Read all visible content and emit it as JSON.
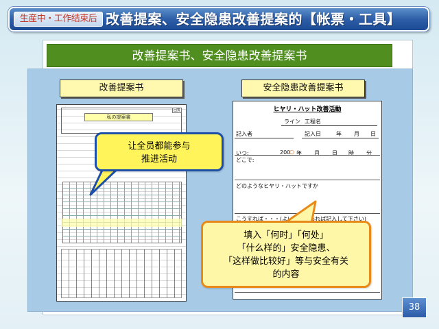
{
  "header": {
    "tag": "生産中・工作结束后",
    "title": "改善提案、安全隐患改善提案的【帐票・工具】"
  },
  "section_title": "改善提案书、安全隐患改善提案书",
  "labels": {
    "left": "改善提案书",
    "right": "安全隐患改善提案书"
  },
  "right_form": {
    "title": "ヒヤリ・ハット改善活動",
    "line_label": "ライン",
    "process_label": "工程名",
    "author_label": "記入者",
    "date_label": "記入日",
    "year": "年",
    "month": "月",
    "day": "日",
    "when_label": "いつ:",
    "when_year": "200",
    "when_day": "日",
    "when_hour": "時",
    "when_minute": "分",
    "where_label": "どこで:",
    "what_label": "どのようなヒヤリ・ハットですか",
    "how_label": "こうすれば・・・(よい方法があれば記入して下さい)"
  },
  "left_form": {
    "stamp_text": "私の提案書",
    "corner_text": "回覧"
  },
  "callouts": {
    "blue": [
      "让全员都能参与",
      "推进活动"
    ],
    "orange": [
      "填入「何时」「何处」",
      "「什么样的」安全隐患、",
      "「这样做比较好」等与安全有关",
      "的内容"
    ]
  },
  "page_number": "38",
  "colors": {
    "title_bar": "#2e5ea8",
    "section_green": "#4f8e1f",
    "panel_blue": "#a7cae6",
    "label_yellow": "#fff9b0",
    "callout_blue_border": "#1d4fa8",
    "callout_orange_border": "#e78a1a"
  }
}
